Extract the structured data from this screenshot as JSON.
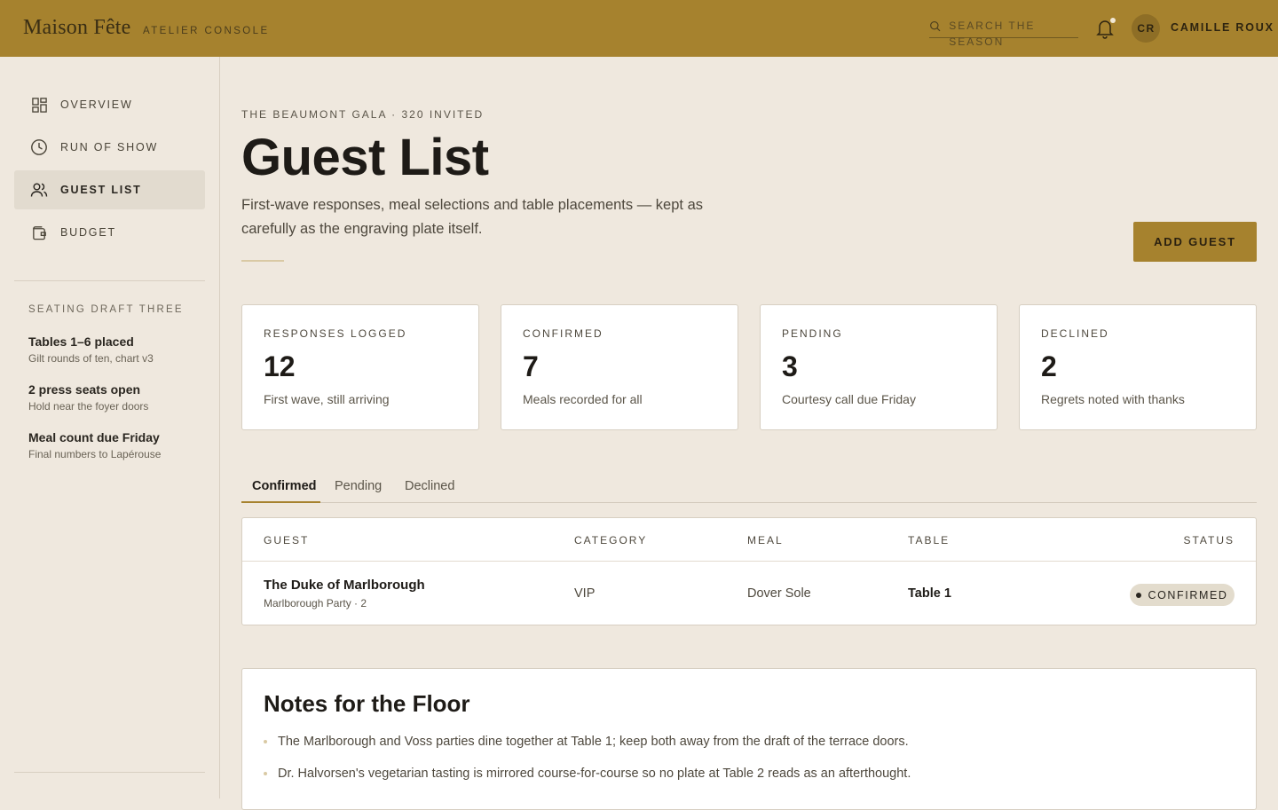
{
  "topbar": {
    "brand": "Maison Fête",
    "brand_sub": "Atelier Console",
    "search_placeholder": "Search the season",
    "avatar_initials": "CR",
    "user_name": "Camille Roux"
  },
  "sidebar": {
    "items": [
      {
        "label": "Overview",
        "icon": "grid-icon"
      },
      {
        "label": "Run of Show",
        "icon": "clock-icon"
      },
      {
        "label": "Guest List",
        "icon": "users-icon",
        "active": true
      },
      {
        "label": "Budget",
        "icon": "wallet-icon"
      }
    ],
    "section_heading": "Seating Draft Three",
    "notes": [
      {
        "title": "Tables 1–6 placed",
        "sub": "Gilt rounds of ten, chart v3"
      },
      {
        "title": "2 press seats open",
        "sub": "Hold near the foyer doors"
      },
      {
        "title": "Meal count due Friday",
        "sub": "Final numbers to Lapérouse"
      }
    ]
  },
  "main": {
    "eyebrow": "The Beaumont Gala · 320 Invited",
    "title": "Guest List",
    "lede": "First-wave responses, meal selections and table placements — kept as carefully as the engraving plate itself.",
    "add_button": "Add Guest"
  },
  "stats": [
    {
      "label": "Responses Logged",
      "value": "12",
      "note": "First wave, still arriving"
    },
    {
      "label": "Confirmed",
      "value": "7",
      "note": "Meals recorded for all"
    },
    {
      "label": "Pending",
      "value": "3",
      "note": "Courtesy call due Friday"
    },
    {
      "label": "Declined",
      "value": "2",
      "note": "Regrets noted with thanks"
    }
  ],
  "tabs": [
    "Confirmed",
    "Pending",
    "Declined"
  ],
  "table": {
    "headers": [
      "Guest",
      "Category",
      "Meal",
      "Table",
      "Status"
    ],
    "rows": [
      {
        "guest": "The Duke of Marlborough",
        "party": "Marlborough Party · 2",
        "category": "VIP",
        "meal": "Dover Sole",
        "table": "Table 1",
        "status": "Confirmed"
      }
    ]
  },
  "notes": {
    "title": "Notes for the Floor",
    "items": [
      "The Marlborough and Voss parties dine together at Table 1; keep both away from the draft of the terrace doors.",
      "Dr. Halvorsen's vegetarian tasting is mirrored course-for-course so no plate at Table 2 reads as an afterthought."
    ]
  },
  "colors": {
    "accent": "#a6822e",
    "background": "#efe8de",
    "card": "#ffffff"
  }
}
